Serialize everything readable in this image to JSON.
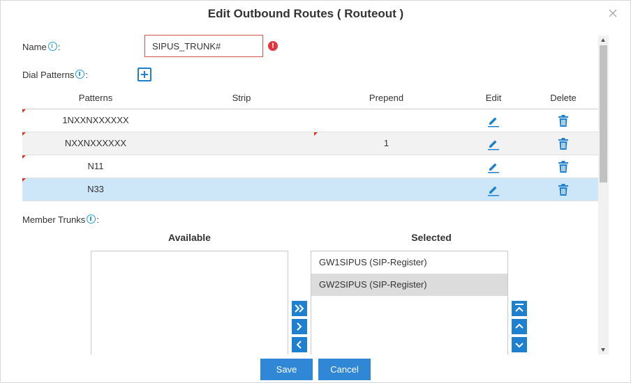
{
  "dialog": {
    "title": "Edit Outbound Routes ( Routeout )"
  },
  "name_field": {
    "label": "Name",
    "suffix": ":",
    "value": "SIPUS_TRUNK#",
    "error": "!"
  },
  "dial_patterns": {
    "label": "Dial Patterns",
    "suffix": ":",
    "columns": [
      "Patterns",
      "Strip",
      "Prepend",
      "Edit",
      "Delete"
    ],
    "rows": [
      {
        "pattern": "1NXXNXXXXXX",
        "strip": "",
        "prepend": ""
      },
      {
        "pattern": "NXXNXXXXXX",
        "strip": "",
        "prepend": "1"
      },
      {
        "pattern": "N11",
        "strip": "",
        "prepend": ""
      },
      {
        "pattern": "N33",
        "strip": "",
        "prepend": ""
      }
    ],
    "selected_row": 3
  },
  "member_trunks": {
    "label": "Member Trunks",
    "suffix": ":",
    "available_header": "Available",
    "selected_header": "Selected",
    "available": [],
    "selected": [
      "GW1SIPUS (SIP-Register)",
      "GW2SIPUS (SIP-Register)"
    ],
    "highlighted_selected": 1
  },
  "footer": {
    "save": "Save",
    "cancel": "Cancel"
  },
  "colors": {
    "accent": "#1f80d0",
    "error": "#e0373f",
    "selected_row": "#cde6f8"
  },
  "icons": {
    "close": "close-icon",
    "info": "info-icon",
    "add": "add-icon",
    "edit": "pencil-icon",
    "delete": "trash-icon"
  }
}
